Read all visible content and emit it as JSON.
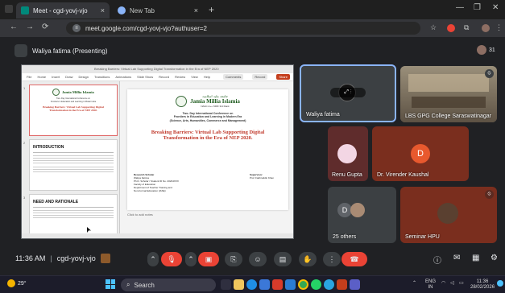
{
  "browser": {
    "tabs": [
      {
        "label": "Meet - cgd-yovj-vjo",
        "favicon_color": "#00897b",
        "active": true
      },
      {
        "label": "New Tab",
        "favicon_color": "#8ab4f8",
        "active": false
      }
    ],
    "url": "meet.google.com/cgd-yovj-vjo?authuser=2",
    "nav_icons": [
      "back-icon",
      "forward-icon",
      "reload-icon"
    ]
  },
  "meet": {
    "presenting_label": "Waliya fatima (Presenting)",
    "participant_count": "31",
    "time": "11:36 AM",
    "meeting_code": "cgd-yovj-vjo",
    "colors": {
      "bg": "#202124",
      "accent_blue": "#8ab4f8",
      "end_red": "#ea4335"
    }
  },
  "shared_screen": {
    "title_bar": "Breaking Barriers: Virtual Lab Supporting Digital Transformation in the Era of NEP 2020",
    "ribbon_tabs": [
      "File",
      "Home",
      "Insert",
      "Draw",
      "Design",
      "Transitions",
      "Animations",
      "Slide Show",
      "Record",
      "Review",
      "View",
      "Help"
    ],
    "ribbon_buttons": [
      "Comments",
      "Record",
      "Share"
    ],
    "notes_placeholder": "Click to add notes",
    "slide": {
      "university_urdu": "جامعہ ملیہ اسلامیہ",
      "university": "Jamia Millia Islamia",
      "naac": "NAAC A++ NIRF 3rd Rank",
      "conference_lines": [
        "Two- Day International Conference on",
        "Frontiers in Education and Learning in Modern Era",
        "(Science, Arts, Humanities, Commerce and Management)"
      ],
      "paper_title_1": "Breaking Barriers: Virtual Lab Supporting Digital",
      "paper_title_2": "Transformation in the Era of  NEP 2020.",
      "scholar_block": [
        "Research Scholar",
        "Waliya Fatima",
        "Ph.D. Scholar / Student ID No. 20234XXX",
        "Faculty of Education",
        "Department of Teacher Training and",
        "Non-Formal Education (IASE)"
      ],
      "supervisor_block": [
        "Supervisor",
        "Prof. Fakhruddin Khan"
      ]
    },
    "thumbnails": [
      {
        "num": "1"
      },
      {
        "num": "2",
        "heading": "INTRODUCTION"
      },
      {
        "num": "3",
        "heading": "NEED AND RATIONALE"
      }
    ]
  },
  "participants": [
    {
      "name": "Waliya fatima",
      "type": "video",
      "bg": "#3c4043"
    },
    {
      "name": "LBS GPG College Saraswatinagar",
      "type": "video",
      "bg": "#6d6151"
    },
    {
      "name": "Renu Gupta",
      "type": "avatar",
      "bg": "#5f2c2c",
      "circle": "#f3d6e4"
    },
    {
      "name": "Dr. Virender Kaushal",
      "type": "letter",
      "letter": "D",
      "bg": "#7a2e1e",
      "circle": "#e8592e"
    },
    {
      "name": "25 others",
      "type": "others",
      "letter": "D",
      "bg": "#3c4043"
    },
    {
      "name": "Seminar HPU",
      "type": "avatar",
      "bg": "#7a2e1e",
      "circle": "#5a4030"
    }
  ],
  "taskbar": {
    "search_placeholder": "Search",
    "lang_1": "ENG",
    "lang_2": "IN",
    "time": "11:36",
    "date": "28/02/2026",
    "weather": "29°"
  }
}
